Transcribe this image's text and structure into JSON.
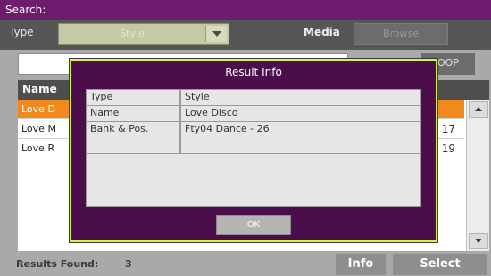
{
  "window": {
    "title": "Search:"
  },
  "filters": {
    "type_label": "Type",
    "type_value": "Style",
    "media_label": "Media",
    "browse_label": "Browse"
  },
  "search": {
    "value": "",
    "find_label": "OOP"
  },
  "list": {
    "name_header": "Name",
    "rows": [
      {
        "name": "Love D",
        "value": "",
        "selected": true
      },
      {
        "name": "Love M",
        "value": "17",
        "selected": false
      },
      {
        "name": "Love R",
        "value": "19",
        "selected": false
      }
    ]
  },
  "footer": {
    "results_label": "Results Found:",
    "results_count": "3",
    "info_label": "Info",
    "select_label": "Select"
  },
  "dialog": {
    "title": "Result Info",
    "rows": [
      {
        "key": "Type",
        "value": "Style"
      },
      {
        "key": "Name",
        "value": "Love Disco"
      },
      {
        "key": "Bank & Pos.",
        "value": "Fty04 Dance - 26"
      }
    ],
    "ok_label": "OK"
  },
  "colors": {
    "title_bar": "#6e1c6e",
    "dialog_bg": "#4b0d4b",
    "dialog_border": "#d4f04a",
    "selected_row": "#f18a1c"
  }
}
